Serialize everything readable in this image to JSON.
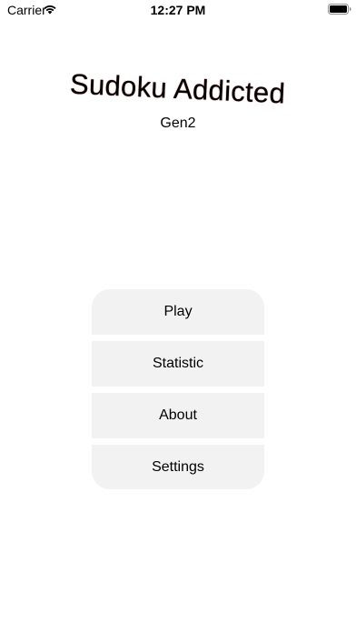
{
  "status_bar": {
    "carrier": "Carrier",
    "time": "12:27 PM",
    "wifi_icon": "wifi-icon",
    "battery_icon": "battery-full-icon"
  },
  "header": {
    "title": "Sudoku Addicted",
    "subtitle": "Gen2"
  },
  "menu": {
    "items": [
      {
        "label": "Play"
      },
      {
        "label": "Statistic"
      },
      {
        "label": "About"
      },
      {
        "label": "Settings"
      }
    ]
  },
  "colors": {
    "background": "#ffffff",
    "button_background": "#f2f2f2",
    "text": "#000000"
  }
}
